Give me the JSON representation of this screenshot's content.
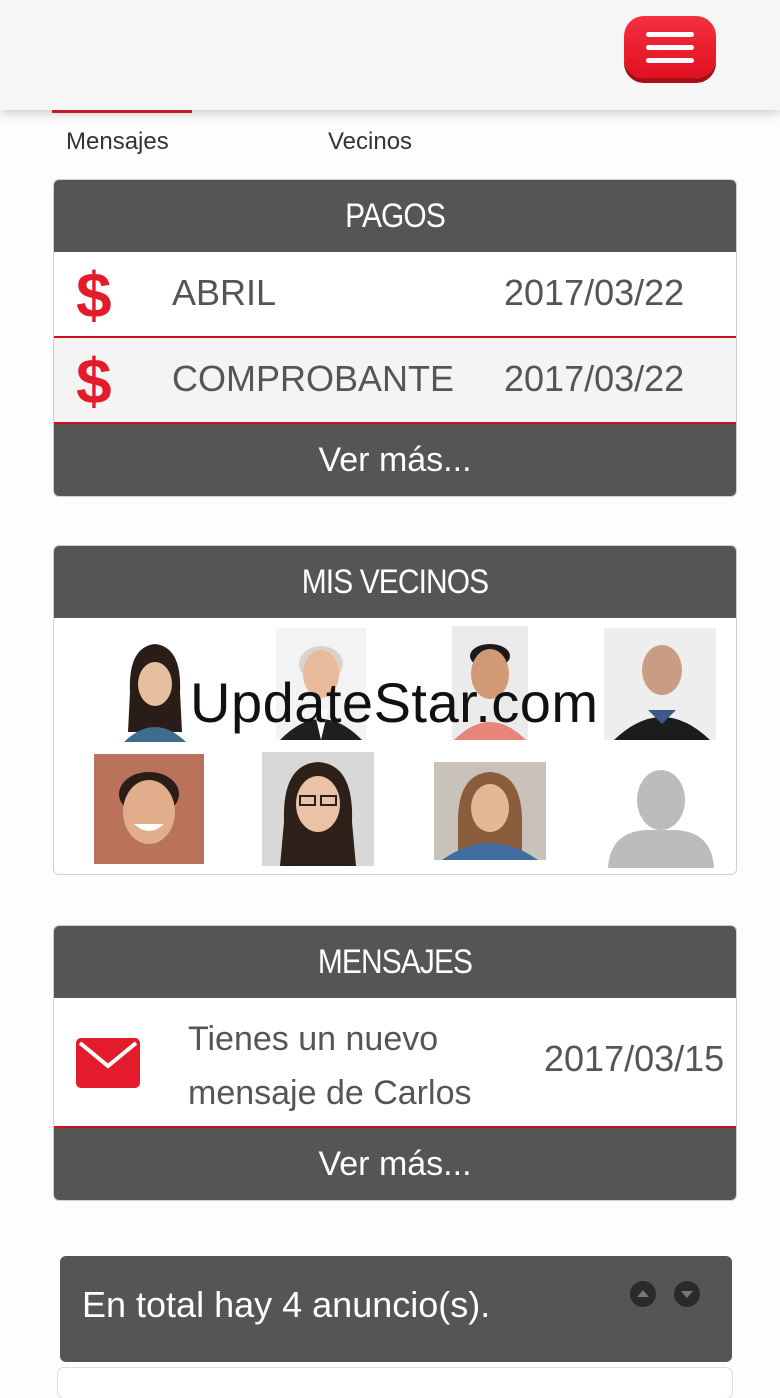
{
  "tabs": {
    "mensajes": "Mensajes",
    "vecinos": "Vecinos"
  },
  "pagos": {
    "title": "PAGOS",
    "rows": [
      {
        "icon": "dollar-icon",
        "symbol": "$",
        "label": "ABRIL",
        "date": "2017/03/22"
      },
      {
        "icon": "dollar-icon",
        "symbol": "$",
        "label": "COMPROBANTE",
        "date": "2017/03/22"
      }
    ],
    "more": "Ver más..."
  },
  "vecinos": {
    "title": "MIS VECINOS"
  },
  "watermark": "UpdateStar.com",
  "mensajes": {
    "title": "MENSAJES",
    "rows": [
      {
        "icon": "envelope-icon",
        "line1": "Tienes un nuevo",
        "line2": "mensaje de Carlos",
        "date": "2017/03/15"
      }
    ],
    "more": "Ver más..."
  },
  "anuncios": {
    "text": "En total hay 4 anuncio(s)."
  },
  "colors": {
    "accent": "#e31b2b",
    "header": "#555555"
  }
}
